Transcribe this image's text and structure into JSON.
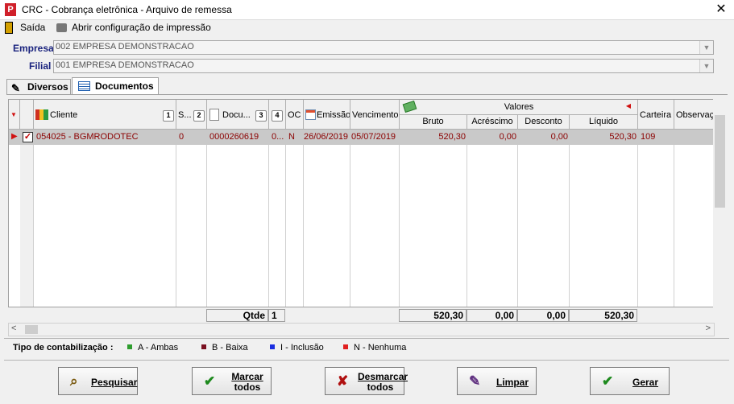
{
  "window": {
    "title": "CRC - Cobrança eletrônica - Arquivo de remessa",
    "app_icon": "P",
    "close": "✕"
  },
  "menu": {
    "exit_label": "Saída",
    "print_config_label": "Abrir configuração de impressão"
  },
  "fields": {
    "empresa_label": "Empresa",
    "empresa_value": "002 EMPRESA DEMONSTRACAO",
    "filial_label": "Filial",
    "filial_value": "001 EMPRESA DEMONSTRACAO"
  },
  "tabs": [
    {
      "label": "Diversos",
      "icon": "pencil-icon"
    },
    {
      "label": "Documentos",
      "icon": "table-icon",
      "active": true
    }
  ],
  "grid": {
    "headers": {
      "cliente": "Cliente",
      "s": "S...",
      "documento": "Docu...",
      "oc": "OC",
      "emissao": "Emissão",
      "vencimento": "Vencimento",
      "valores": "Valores",
      "bruto": "Bruto",
      "acrescimo": "Acréscimo",
      "desconto": "Desconto",
      "liquido": "Líquido",
      "carteira": "Carteira",
      "observacao": "Observaç"
    },
    "sort_numbers": [
      "1",
      "2",
      "3",
      "4"
    ],
    "rows": [
      {
        "checked": true,
        "cliente": "054025 - BGMRODOTEC",
        "s": "0",
        "documento": "0000260619",
        "col4": "0...",
        "oc": "N",
        "emissao": "26/06/2019",
        "vencimento": "05/07/2019",
        "bruto": "520,30",
        "acrescimo": "0,00",
        "desconto": "0,00",
        "liquido": "520,30",
        "carteira": "109"
      }
    ],
    "row_text_color": "#8b0000",
    "selected_row_bg": "#c9c9c9"
  },
  "totals": {
    "qtde_label": "Qtde",
    "qtde_value": "1",
    "bruto": "520,30",
    "acrescimo": "0,00",
    "desconto": "0,00",
    "liquido": "520,30"
  },
  "legend": {
    "title": "Tipo de contabilização :",
    "items": [
      {
        "label": "A - Ambas",
        "color": "#2e9d2e"
      },
      {
        "label": "B - Baixa",
        "color": "#7a1020"
      },
      {
        "label": "I - Inclusão",
        "color": "#1a2ee0"
      },
      {
        "label": "N - Nenhuma",
        "color": "#e02020"
      }
    ]
  },
  "buttons": {
    "pesquisar": "Pesquisar",
    "marcar_1": "Marcar",
    "marcar_2": "todos",
    "desmarcar_1": "Desmarcar",
    "desmarcar_2": "todos",
    "limpar": "Limpar",
    "gerar": "Gerar"
  }
}
